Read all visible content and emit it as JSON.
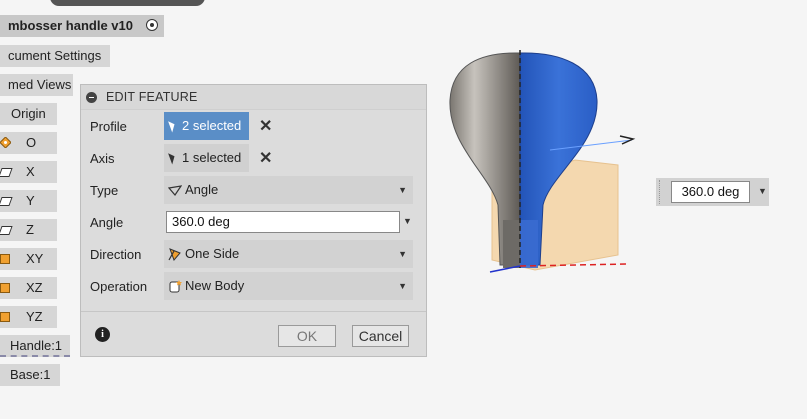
{
  "browser": {
    "document_title": "mbosser handle v10",
    "items": {
      "document_settings": "cument Settings",
      "named_views": "med Views",
      "origin": "Origin",
      "origin_point": "O",
      "x": "X",
      "y": "Y",
      "z": "Z",
      "xy": "XY",
      "xz": "XZ",
      "yz": "YZ",
      "handle": "Handle:1",
      "base": "Base:1"
    }
  },
  "dialog": {
    "title": "EDIT FEATURE",
    "profile": {
      "label": "Profile",
      "value": "2 selected"
    },
    "axis": {
      "label": "Axis",
      "value": "1 selected"
    },
    "type": {
      "label": "Type",
      "value": "Angle"
    },
    "angle": {
      "label": "Angle",
      "value": "360.0 deg"
    },
    "direction": {
      "label": "Direction",
      "value": "One Side"
    },
    "operation": {
      "label": "Operation",
      "value": "New Body"
    },
    "ok_label": "OK",
    "cancel_label": "Cancel"
  },
  "manipulator": {
    "value": "360.0 deg"
  },
  "colors": {
    "selection_blue": "#5a8ec7",
    "body_blue": "#2f62c8",
    "plane_orange": "#f4c98a"
  }
}
